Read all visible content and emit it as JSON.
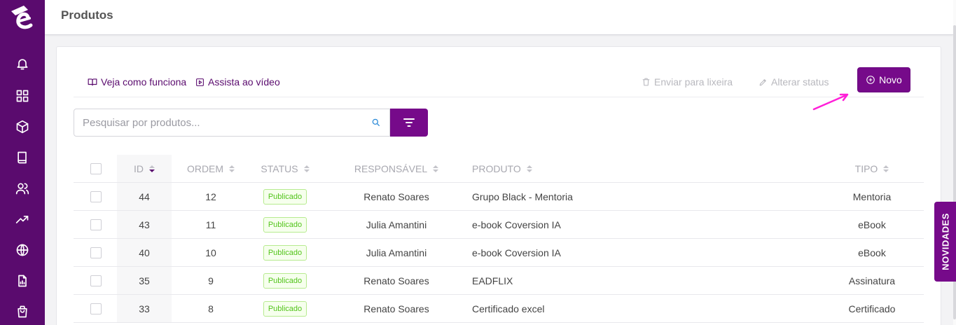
{
  "sidebar": {
    "items": [
      {
        "icon": "bell-icon"
      },
      {
        "icon": "grid-icon"
      },
      {
        "icon": "box-icon"
      },
      {
        "icon": "book-icon"
      },
      {
        "icon": "users-icon"
      },
      {
        "icon": "trending-up-icon"
      },
      {
        "icon": "globe-icon"
      },
      {
        "icon": "report-icon"
      },
      {
        "icon": "shopping-bag-icon"
      }
    ]
  },
  "header": {
    "title": "Produtos"
  },
  "toolbar": {
    "how_it_works": "Veja como funciona",
    "watch_video": "Assista ao vídeo",
    "send_to_trash": "Enviar para lixeira",
    "change_status": "Alterar status",
    "new_label": "Novo"
  },
  "search": {
    "placeholder": "Pesquisar por produtos..."
  },
  "table": {
    "columns": {
      "id": "ID",
      "ordem": "ORDEM",
      "status": "STATUS",
      "responsavel": "RESPONSÁVEL",
      "produto": "PRODUTO",
      "tipo": "TIPO"
    },
    "rows": [
      {
        "id": "44",
        "ordem": "12",
        "status": "Publicado",
        "responsavel": "Renato Soares",
        "produto": "Grupo Black - Mentoria",
        "tipo": "Mentoria"
      },
      {
        "id": "43",
        "ordem": "11",
        "status": "Publicado",
        "responsavel": "Julia Amantini",
        "produto": "e-book Coversion IA",
        "tipo": "eBook"
      },
      {
        "id": "40",
        "ordem": "10",
        "status": "Publicado",
        "responsavel": "Julia Amantini",
        "produto": "e-book Coversion IA",
        "tipo": "eBook"
      },
      {
        "id": "35",
        "ordem": "9",
        "status": "Publicado",
        "responsavel": "Renato Soares",
        "produto": "EADFLIX",
        "tipo": "Assinatura"
      },
      {
        "id": "33",
        "ordem": "8",
        "status": "Publicado",
        "responsavel": "Renato Soares",
        "produto": "Certificado excel",
        "tipo": "Certificado"
      }
    ]
  },
  "novidades": {
    "label": "NOVIDADES"
  },
  "colors": {
    "sidebar": "#5a0b6e",
    "accent": "#760a8a",
    "published_green": "#52c41a",
    "annotation_arrow": "#ff1fd8"
  }
}
